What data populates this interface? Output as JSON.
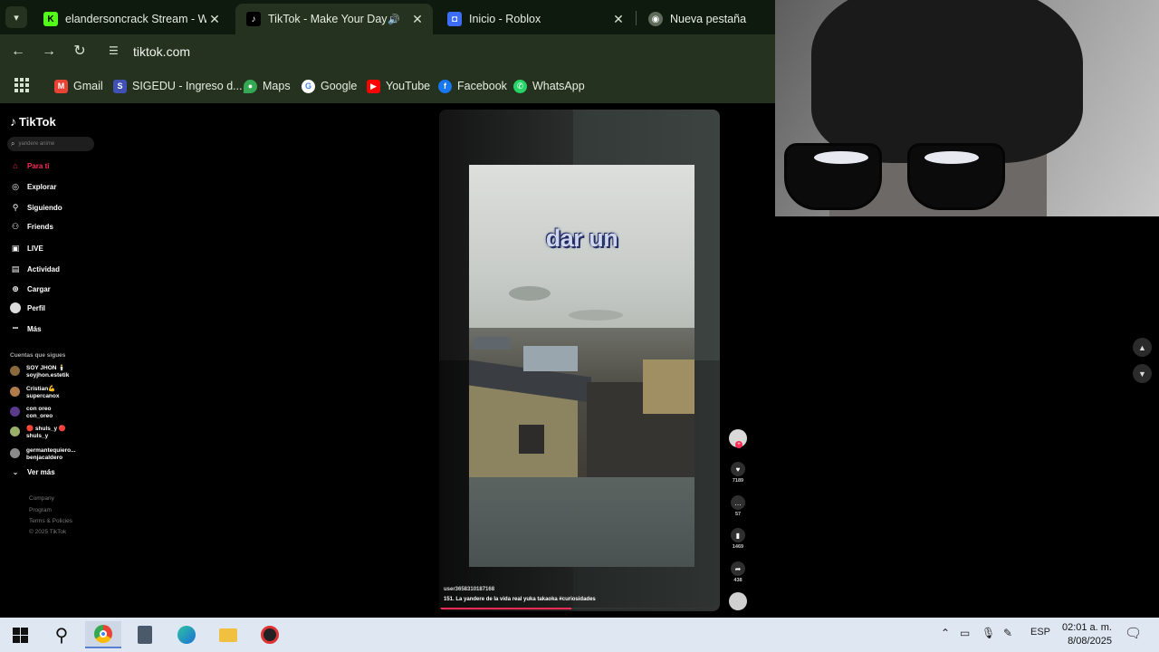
{
  "browser": {
    "tabs": [
      {
        "title": "elandersoncrack Stream - Watc",
        "favicon": "kick-icon",
        "color": "#53fc18",
        "glyph": "K"
      },
      {
        "title": "TikTok - Make Your Day",
        "favicon": "tiktok-icon",
        "color": "#000000",
        "glyph": "♪",
        "active": true,
        "audio": "speaker-icon"
      },
      {
        "title": "Inicio - Roblox",
        "favicon": "roblox-icon",
        "color": "#3b6df6",
        "glyph": "◘"
      },
      {
        "title": "Nueva pestaña",
        "favicon": "chrome-icon",
        "color": "#5f6b5a",
        "glyph": "◉"
      }
    ],
    "close_glyph": "✕",
    "url": "tiktok.com",
    "bookmarks": [
      {
        "label": "Gmail",
        "icon": "gmail-icon",
        "color": "#ea4335",
        "glyph": "M"
      },
      {
        "label": "SIGEDU - Ingreso d...",
        "icon": "sigedu-icon",
        "color": "#3f51b5",
        "glyph": "S"
      },
      {
        "label": "Maps",
        "icon": "maps-icon",
        "color": "#34a853",
        "glyph": "●"
      },
      {
        "label": "Google",
        "icon": "google-icon",
        "color": "#4285f4",
        "glyph": "G"
      },
      {
        "label": "YouTube",
        "icon": "youtube-icon",
        "color": "#ff0000",
        "glyph": "▶"
      },
      {
        "label": "Facebook",
        "icon": "facebook-icon",
        "color": "#1877f2",
        "glyph": "f"
      },
      {
        "label": "WhatsApp",
        "icon": "whatsapp-icon",
        "color": "#25d366",
        "glyph": "✆"
      }
    ]
  },
  "tiktok": {
    "logo": "TikTok",
    "search_placeholder": "yandere anime",
    "menu": [
      {
        "label": "Para ti",
        "icon": "home-icon",
        "glyph": "⌂",
        "selected": true
      },
      {
        "label": "Explorar",
        "icon": "compass-icon",
        "glyph": "◎"
      },
      {
        "label": "Siguiendo",
        "icon": "following-icon",
        "glyph": "⚲"
      },
      {
        "label": "Friends",
        "icon": "friends-icon",
        "glyph": "⚇"
      },
      {
        "label": "LIVE",
        "icon": "live-icon",
        "glyph": "▣"
      },
      {
        "label": "Actividad",
        "icon": "activity-icon",
        "glyph": "▤"
      },
      {
        "label": "Cargar",
        "icon": "upload-icon",
        "glyph": "⊕"
      },
      {
        "label": "Perfil",
        "icon": "profile-icon",
        "glyph": "●"
      },
      {
        "label": "Más",
        "icon": "more-icon",
        "glyph": "•••"
      }
    ],
    "following_title": "Cuentas que sigues",
    "following": [
      {
        "line1": "SOY JHON 🕯️",
        "line2": "soyjhon.estetik",
        "color": "#8a6a3c"
      },
      {
        "line1": "Cristian💪",
        "line2": "supercanox",
        "color": "#b07a4a"
      },
      {
        "line1": "con oreo",
        "line2": "con_oreo",
        "color": "#5a3a8a"
      },
      {
        "line1": "🔴 shuls_y 🔴",
        "line2": "shuls_y",
        "color": "#9ab06a"
      },
      {
        "line1": "germantequiero...",
        "line2": "benjacaldero",
        "color": "#8a8a8a"
      }
    ],
    "see_more": "Ver más",
    "footer": [
      "Company",
      "Program",
      "Terms & Policies",
      "© 2025 TikTok"
    ]
  },
  "video": {
    "caption": "dar un",
    "username": "user3658310187168",
    "description": "151. La yandere de la vida real  yuka takaoka #curiosidades",
    "progress": 0.47,
    "actions": [
      {
        "icon": "heart-icon",
        "glyph": "♥",
        "count": "7189"
      },
      {
        "icon": "comment-icon",
        "glyph": "…",
        "count": "57"
      },
      {
        "icon": "bookmark-icon",
        "glyph": "▮",
        "count": "1469"
      },
      {
        "icon": "share-icon",
        "glyph": "➦",
        "count": "438"
      }
    ]
  },
  "taskbar": {
    "apps": [
      "start-icon",
      "search-icon",
      "chrome-icon",
      "calculator-icon",
      "edge-icon",
      "file-explorer-icon",
      "app-icon"
    ],
    "language": "ESP",
    "time": "02:01 a. m.",
    "date": "8/08/2025"
  }
}
